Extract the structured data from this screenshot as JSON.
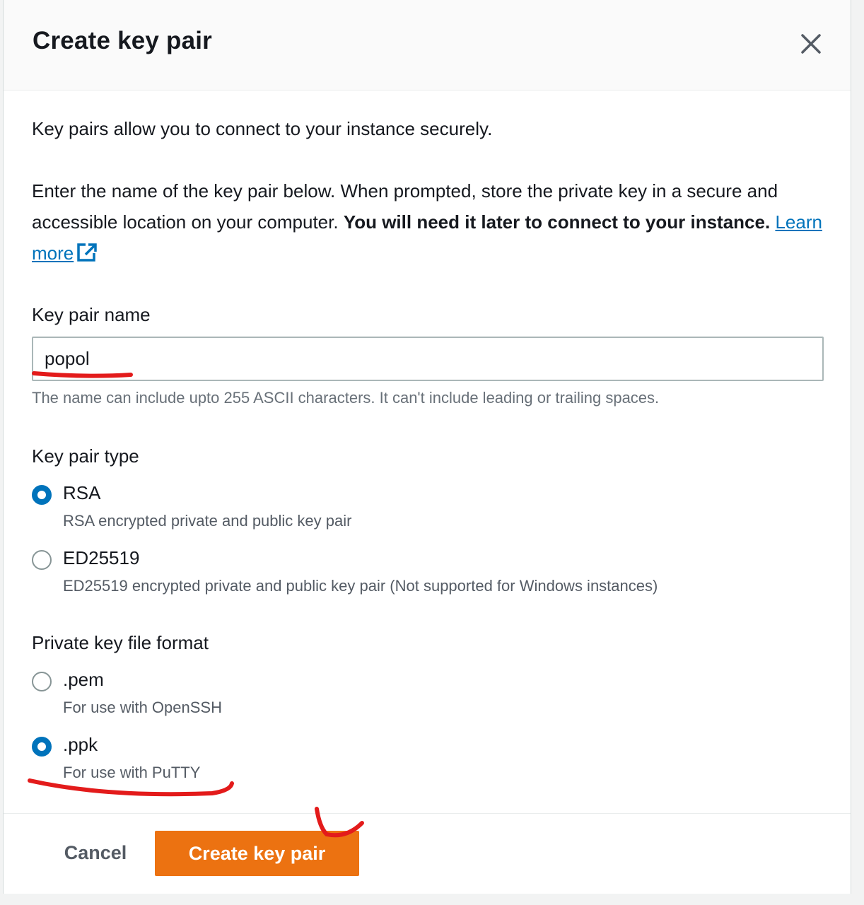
{
  "modal": {
    "title": "Create key pair",
    "close_label": "Close"
  },
  "intro": {
    "line1": "Key pairs allow you to connect to your instance securely.",
    "line2_plain": "Enter the name of the key pair below. When prompted, store the private key in a secure and accessible location on your computer.",
    "line2_bold": "You will need it later to connect to your instance.",
    "learn_more": "Learn more"
  },
  "key_pair_name": {
    "label": "Key pair name",
    "value": "popol",
    "hint": "The name can include upto 255 ASCII characters. It can't include leading or trailing spaces."
  },
  "key_pair_type": {
    "label": "Key pair type",
    "options": [
      {
        "title": "RSA",
        "description": "RSA encrypted private and public key pair",
        "selected": true
      },
      {
        "title": "ED25519",
        "description": "ED25519 encrypted private and public key pair (Not supported for Windows instances)",
        "selected": false
      }
    ]
  },
  "private_key_format": {
    "label": "Private key file format",
    "options": [
      {
        "title": ".pem",
        "description": "For use with OpenSSH",
        "selected": false
      },
      {
        "title": ".ppk",
        "description": "For use with PuTTY",
        "selected": true
      }
    ]
  },
  "footer": {
    "cancel_label": "Cancel",
    "create_label": "Create key pair"
  },
  "colors": {
    "primary_button": "#ec7211",
    "link": "#0073bb",
    "radio_selected": "#0073bb",
    "annotation": "#e31b1b"
  },
  "icons": {
    "close": "close-icon",
    "external_link": "external-link-icon"
  }
}
